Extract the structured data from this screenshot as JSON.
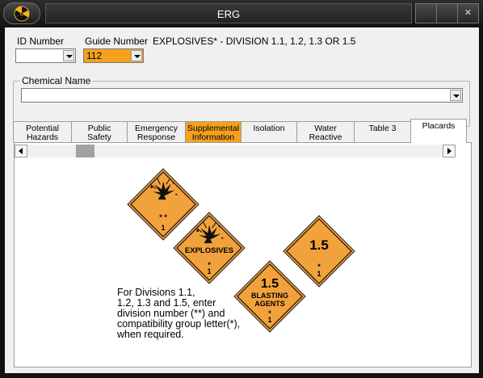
{
  "window": {
    "title": "ERG"
  },
  "title_buttons": {
    "minimize": "",
    "maximize": "",
    "close": "✕"
  },
  "form": {
    "id_number_label": "ID Number",
    "id_number_value": "",
    "guide_number_label": "Guide Number",
    "guide_number_value": "112",
    "guide_title": "EXPLOSIVES* - DIVISION 1.1, 1.2, 1.3 OR 1.5",
    "chemical_name_label": "Chemical Name",
    "chemical_name_value": ""
  },
  "tabs": [
    {
      "line1": "Potential",
      "line2": "Hazards"
    },
    {
      "line1": "Public",
      "line2": "Safety"
    },
    {
      "line1": "Emergency",
      "line2": "Response"
    },
    {
      "line1": "Supplemental",
      "line2": "Information"
    },
    {
      "line1": "Isolation",
      "line2": ""
    },
    {
      "line1": "Water",
      "line2": "Reactive"
    },
    {
      "line1": "Table 3",
      "line2": ""
    },
    {
      "line1": "Placards",
      "line2": ""
    }
  ],
  "active_tab": "Placards",
  "highlight_color": "#f4a21e",
  "placards": {
    "placard_1": {
      "stars": "* *",
      "number": "1"
    },
    "placard_2": {
      "word": "EXPLOSIVES",
      "star": "*",
      "number": "1"
    },
    "placard_3": {
      "division": "1.5",
      "star": "*",
      "number": "1"
    },
    "placard_4": {
      "division": "1.5",
      "word1": "BLASTING",
      "word2": "AGENTS",
      "star": "*",
      "number": "1"
    }
  },
  "note_lines": [
    "For Divisions 1.1,",
    "1.2, 1.3 and 1.5, enter",
    "division number (**) and",
    "compatibility group letter(*),",
    "when required."
  ]
}
